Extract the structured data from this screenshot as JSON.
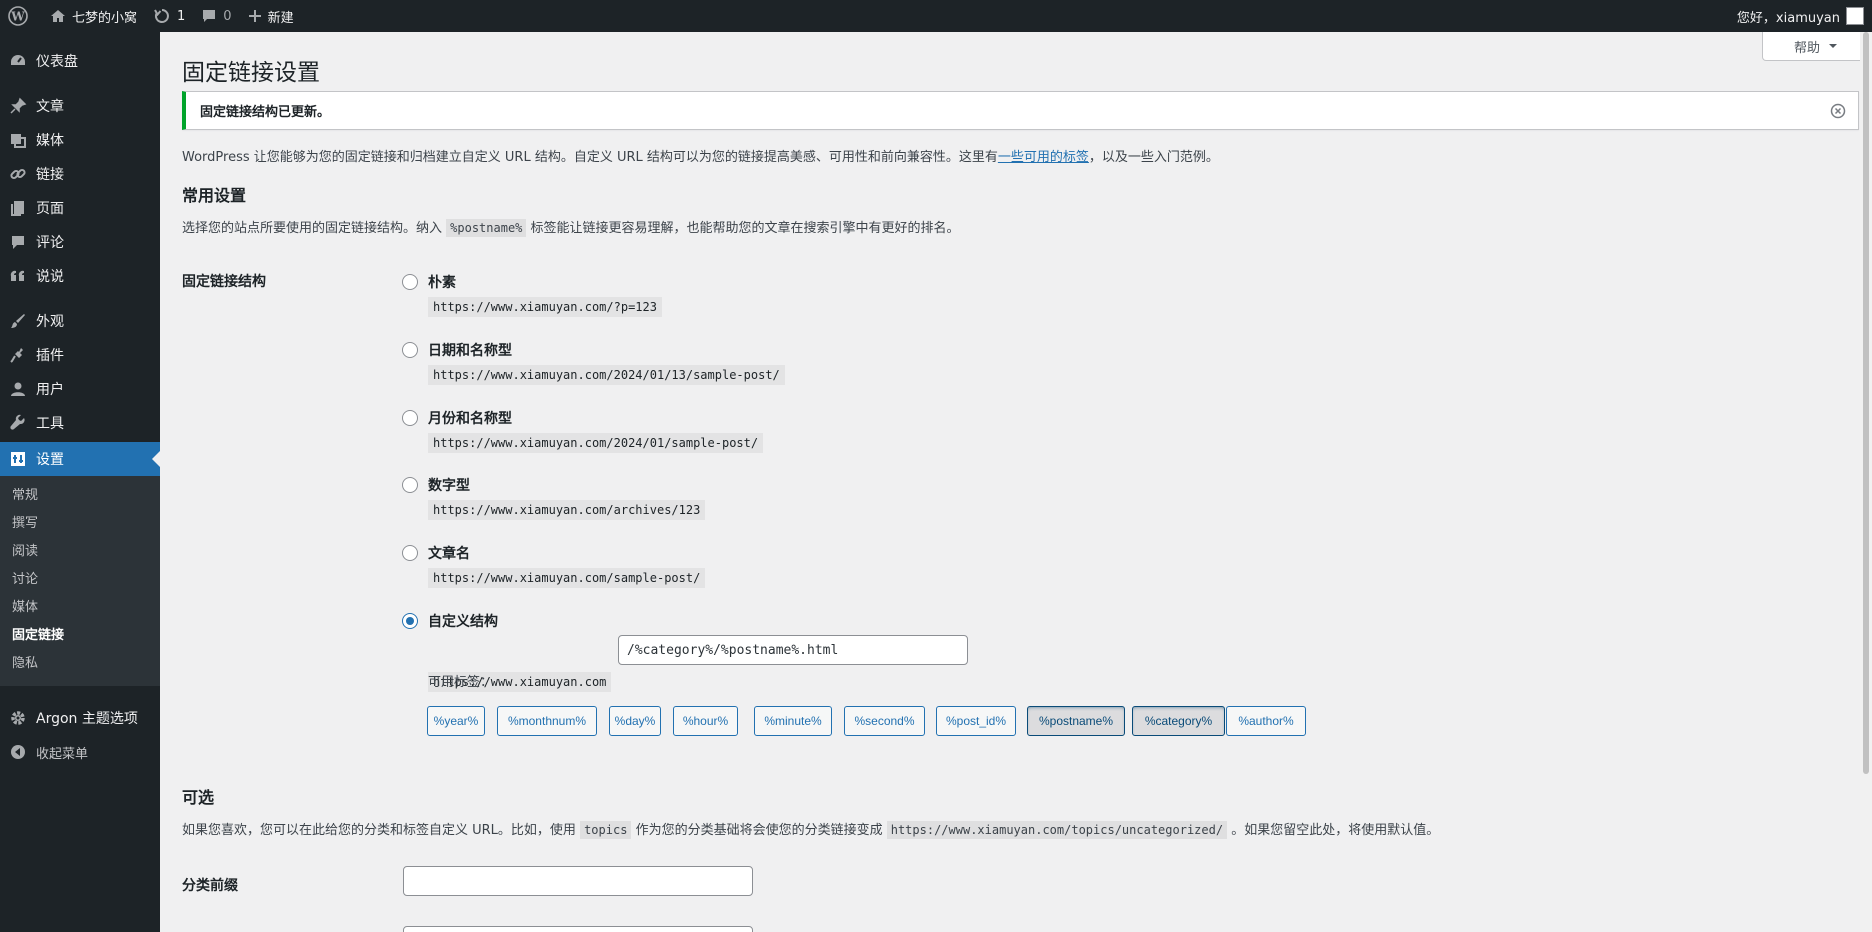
{
  "adminbar": {
    "site_name": "七梦的小窝",
    "updates_count": "1",
    "comments_count": "0",
    "new_label": "新建",
    "greeting": "您好，xiamuyan"
  },
  "sidebar": {
    "items": [
      {
        "label": "仪表盘",
        "icon": "dashboard-icon"
      },
      {
        "label": "文章",
        "icon": "pin-icon"
      },
      {
        "label": "媒体",
        "icon": "media-icon"
      },
      {
        "label": "链接",
        "icon": "link-icon"
      },
      {
        "label": "页面",
        "icon": "page-icon"
      },
      {
        "label": "评论",
        "icon": "comment-icon"
      },
      {
        "label": "说说",
        "icon": "quote-icon"
      },
      {
        "label": "外观",
        "icon": "brush-icon"
      },
      {
        "label": "插件",
        "icon": "plugin-icon"
      },
      {
        "label": "用户",
        "icon": "user-icon"
      },
      {
        "label": "工具",
        "icon": "wrench-icon"
      },
      {
        "label": "设置",
        "icon": "settings-icon"
      },
      {
        "label": "Argon 主题选项",
        "icon": "gear-icon"
      },
      {
        "label": "收起菜单",
        "icon": "collapse-icon"
      }
    ],
    "submenu": [
      "常规",
      "撰写",
      "阅读",
      "讨论",
      "媒体",
      "固定链接",
      "隐私"
    ]
  },
  "help_label": "帮助",
  "page_title": "固定链接设置",
  "notice": "固定链接结构已更新。",
  "intro": {
    "before": "WordPress 让您能够为您的固定链接和归档建立自定义 URL 结构。自定义 URL 结构可以为您的链接提高美感、可用性和前向兼容性。这里有",
    "link": "一些可用的标签",
    "after": "，以及一些入门范例。"
  },
  "common": {
    "heading": "常用设置",
    "desc_before": "选择您的站点所要使用的固定链接结构。纳入",
    "desc_code": "%postname%",
    "desc_after": "标签能让链接更容易理解，也能帮助您的文章在搜索引擎中有更好的排名。",
    "th_label": "固定链接结构",
    "options": [
      {
        "label": "朴素",
        "example": "https://www.xiamuyan.com/?p=123",
        "checked": false
      },
      {
        "label": "日期和名称型",
        "example": "https://www.xiamuyan.com/2024/01/13/sample-post/",
        "checked": false
      },
      {
        "label": "月份和名称型",
        "example": "https://www.xiamuyan.com/2024/01/sample-post/",
        "checked": false
      },
      {
        "label": "数字型",
        "example": "https://www.xiamuyan.com/archives/123",
        "checked": false
      },
      {
        "label": "文章名",
        "example": "https://www.xiamuyan.com/sample-post/",
        "checked": false
      },
      {
        "label": "自定义结构",
        "checked": true
      }
    ],
    "custom_base": "https://www.xiamuyan.com",
    "custom_value": "/%category%/%postname%.html",
    "tags_label": "可用标签：",
    "tags": [
      {
        "label": "%year%",
        "active": false
      },
      {
        "label": "%monthnum%",
        "active": false
      },
      {
        "label": "%day%",
        "active": false
      },
      {
        "label": "%hour%",
        "active": false
      },
      {
        "label": "%minute%",
        "active": false
      },
      {
        "label": "%second%",
        "active": false
      },
      {
        "label": "%post_id%",
        "active": false
      },
      {
        "label": "%postname%",
        "active": true
      },
      {
        "label": "%category%",
        "active": true
      },
      {
        "label": "%author%",
        "active": false
      }
    ]
  },
  "optional": {
    "heading": "可选",
    "desc_before": "如果您喜欢，您可以在此给您的分类和标签自定义 URL。比如，使用",
    "desc_code1": "topics",
    "desc_middle": "作为您的分类基础将会使您的分类链接变成",
    "desc_code2": "https://www.xiamuyan.com/topics/uncategorized/",
    "desc_after": "。如果您留空此处，将使用默认值。",
    "category_base_label": "分类前缀",
    "category_base_value": ""
  },
  "colors": {
    "adminbar_bg": "#1d2327",
    "accent": "#2271b1",
    "notice_success": "#00a32a"
  }
}
